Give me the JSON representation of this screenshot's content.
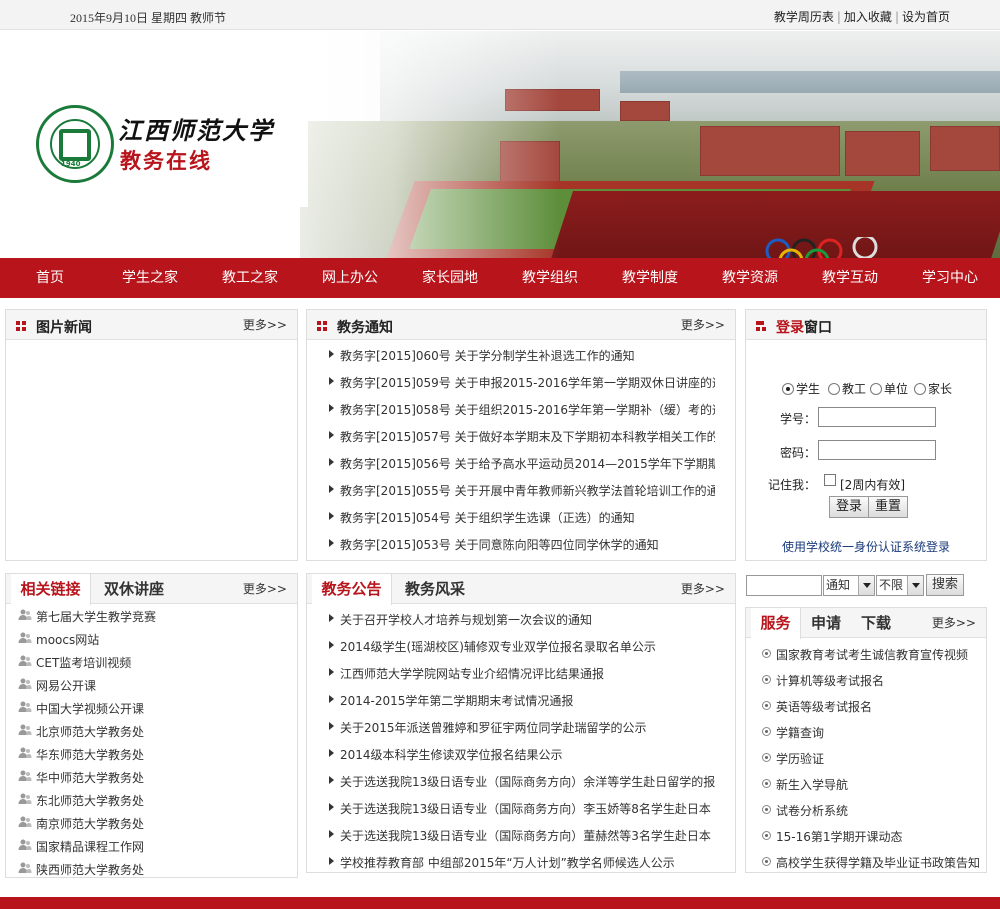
{
  "topbar": {
    "date": "2015年9月10日  星期四 教师节",
    "links": [
      "教学周历表",
      "加入收藏",
      "设为首页"
    ]
  },
  "logo": {
    "title": "江西师范大学",
    "subtitle": "教务在线",
    "seal_year": "1940"
  },
  "nav": [
    "首页",
    "学生之家",
    "教工之家",
    "网上办公",
    "家长园地",
    "教学组织",
    "教学制度",
    "教学资源",
    "教学互动",
    "学习中心"
  ],
  "photo_news": {
    "title": "图片新闻",
    "more": "更多>>"
  },
  "notices": {
    "title": "教务通知",
    "more": "更多>>",
    "items": [
      "教务字[2015]060号  关于学分制学生补退选工作的通知",
      "教务字[2015]059号  关于申报2015-2016学年第一学期双休日讲座的通",
      "教务字[2015]058号  关于组织2015-2016学年第一学期补（缓）考的通",
      "教务字[2015]057号  关于做好本学期末及下学期初本科教学相关工作的",
      "教务字[2015]056号  关于给予高水平运动员2014—2015学年下学期期",
      "教务字[2015]055号  关于开展中青年教师新兴教学法首轮培训工作的通",
      "教务字[2015]054号  关于组织学生选课（正选）的通知",
      "教务字[2015]053号  关于同意陈向阳等四位同学休学的通知"
    ]
  },
  "login": {
    "title_red": "登录",
    "title_rest": "窗口",
    "roles": [
      "学生",
      "教工",
      "单位",
      "家长"
    ],
    "username_label": "学号：",
    "password_label": "密码：",
    "remember_label": "记住我：",
    "remember_hint": "[2周内有效]",
    "login_button": "登录",
    "reset_button": "重置",
    "sso_link": "使用学校统一身份认证系统登录"
  },
  "links": {
    "tabs": [
      "相关链接",
      "双休讲座"
    ],
    "more": "更多>>",
    "items": [
      "第七届大学生教学竞赛",
      "moocs网站",
      "CET监考培训视频",
      "网易公开课",
      "中国大学视频公开课",
      "北京师范大学教务处",
      "华东师范大学教务处",
      "华中师范大学教务处",
      "东北师范大学教务处",
      "南京师范大学教务处",
      "国家精品课程工作网",
      "陕西师范大学教务处"
    ]
  },
  "announcements": {
    "tabs": [
      "教务公告",
      "教务风采"
    ],
    "more": "更多>>",
    "items": [
      "关于召开学校人才培养与规划第一次会议的通知",
      "2014级学生(瑶湖校区)辅修双专业双学位报名录取名单公示",
      "江西师范大学学院网站专业介绍情况评比结果通报",
      "2014-2015学年第二学期期末考试情况通报",
      "关于2015年派送曾雅婷和罗征宇两位同学赴瑞留学的公示",
      "2014级本科学生修读双学位报名结果公示",
      "关于选送我院13级日语专业（国际商务方向）余洋等学生赴日留学的报",
      "关于选送我院13级日语专业（国际商务方向）李玉娇等8名学生赴日本",
      "关于选送我院13级日语专业（国际商务方向）董赫然等3名学生赴日本",
      "学校推荐教育部  中组部2015年“万人计划”教学名师候选人公示"
    ]
  },
  "search": {
    "keyword": "",
    "field_select": "通知",
    "time_select": "不限",
    "button": "搜索"
  },
  "services": {
    "tabs": [
      "服务",
      "申请",
      "下载"
    ],
    "more": "更多>>",
    "items": [
      "国家教育考试考生诚信教育宣传视频",
      "计算机等级考试报名",
      "英语等级考试报名",
      "学籍查询",
      "学历验证",
      "新生入学导航",
      "试卷分析系统",
      "15-16第1学期开课动态",
      "高校学生获得学籍及毕业证书政策告知"
    ]
  },
  "colors": {
    "brand_red": "#b7141b",
    "seal_green": "#1a7a3a"
  }
}
